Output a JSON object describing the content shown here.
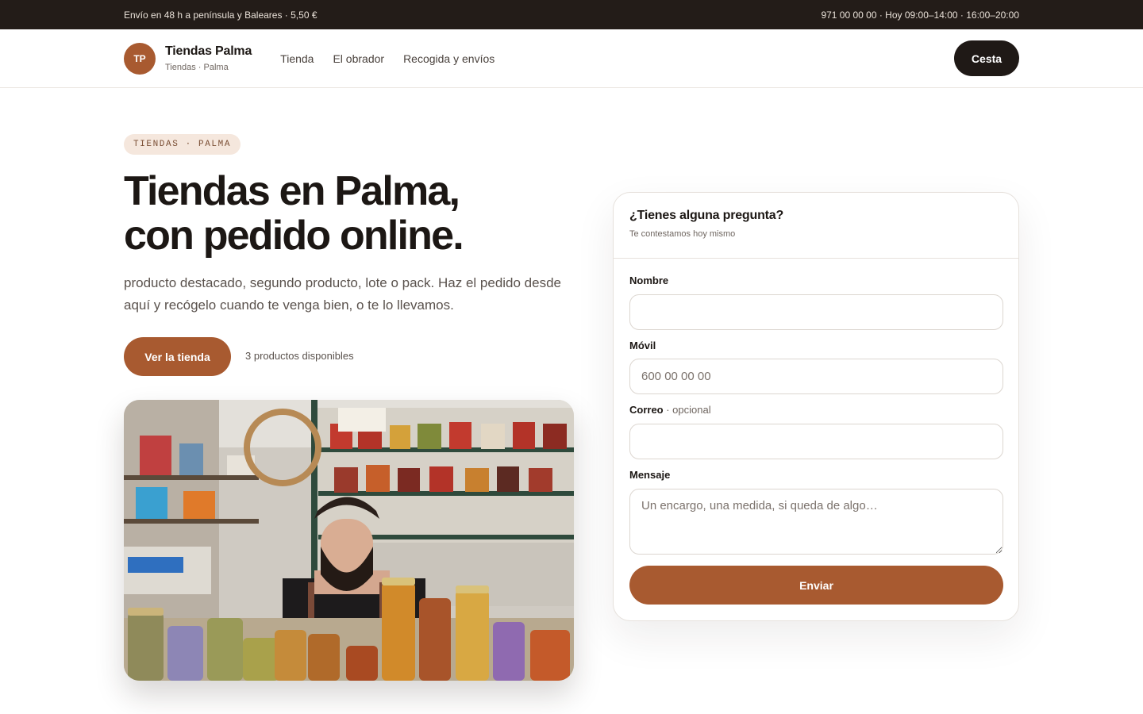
{
  "topbar": {
    "shipping": "Envío en 48 h a península y Baleares · 5,50 €",
    "contact": "971 00 00 00 · Hoy 09:00–14:00 · 16:00–20:00"
  },
  "header": {
    "logo_initials": "TP",
    "brand_name": "Tiendas Palma",
    "brand_sub": "Tiendas · Palma",
    "nav": [
      "Tienda",
      "El obrador",
      "Recogida y envíos"
    ],
    "cart_label": "Cesta"
  },
  "hero": {
    "eyebrow": "TIENDAS · PALMA",
    "headline_line1": "Tiendas en Palma,",
    "headline_line2": "con pedido online.",
    "lede": "producto destacado, segundo producto, lote o pack. Haz el pedido desde aquí y recógelo cuando te venga bien, o te lo llevamos.",
    "cta_label": "Ver la tienda",
    "cta_note": "3 productos disponibles"
  },
  "form": {
    "title": "¿Tienes alguna pregunta?",
    "subtitle": "Te contestamos hoy mismo",
    "name_label": "Nombre",
    "name_value": "",
    "phone_label": "Móvil",
    "phone_placeholder": "600 00 00 00",
    "email_label": "Correo",
    "email_optional": " · opcional",
    "email_value": "",
    "message_label": "Mensaje",
    "message_placeholder": "Un encargo, una medida, si queda de algo…",
    "submit_label": "Enviar"
  },
  "colors": {
    "accent": "#a85a30",
    "dark": "#231c18",
    "pill_bg": "#f5e7dd"
  }
}
